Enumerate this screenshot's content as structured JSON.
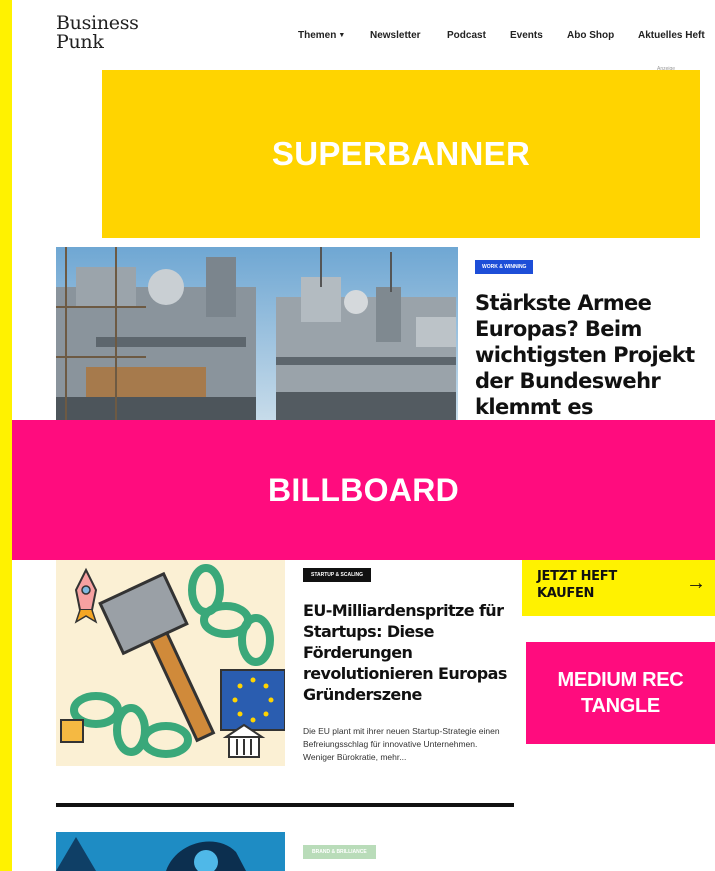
{
  "header": {
    "logo_line1": "Business",
    "logo_line2": "Punk",
    "nav": [
      {
        "label": "Themen",
        "icon": "caret-down-icon"
      },
      {
        "label": "Newsletter"
      },
      {
        "label": "Podcast"
      },
      {
        "label": "Events"
      },
      {
        "label": "Abo Shop"
      },
      {
        "label": "Aktuelles Heft"
      }
    ],
    "ad_label": "Anzeige"
  },
  "ads": {
    "superbanner": "SUPERBANNER",
    "billboard": "BILLBOARD",
    "medium_rectangle": "MEDIUM REC TANGLE"
  },
  "hero": {
    "tag": "WORK & WINNING",
    "title": "Stärkste Armee Europas? Beim wichtigsten Projekt der Bundeswehr klemmt es"
  },
  "article1": {
    "tag": "STARTUP & SCALING",
    "title": "EU-Milliardenspritze für Startups: Diese Förderungen revolutionieren Europas Gründerszene",
    "excerpt": "Die EU plant mit ihrer neuen Startup-Strategie einen Befreiungsschlag für innovative Unternehmen. Weniger Bürokratie, mehr..."
  },
  "sidebar": {
    "buy_label": "JETZT HEFT KAUFEN",
    "buy_icon": "arrow-right-icon"
  },
  "article2": {
    "tag": "BRAND & BRILLIANCE"
  },
  "colors": {
    "frame": "#fff200",
    "superbanner": "#ffd400",
    "billboard": "#ff0c7e",
    "hero_tag": "#1d4ed8",
    "brand_tag": "#b9dcb9"
  }
}
